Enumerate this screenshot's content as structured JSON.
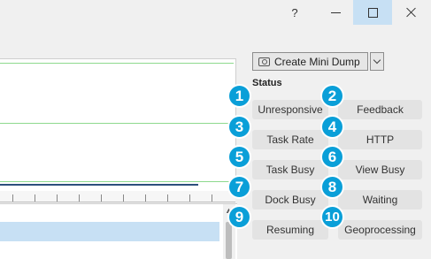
{
  "titlebar": {
    "help_label": "?"
  },
  "toolbar": {
    "mini_dump_label": "Create Mini Dump"
  },
  "status": {
    "label": "Status",
    "buttons": [
      {
        "label": "Unresponsive",
        "badge": "1"
      },
      {
        "label": "Feedback",
        "badge": "2"
      },
      {
        "label": "Task Rate",
        "badge": "3"
      },
      {
        "label": "HTTP",
        "badge": "4"
      },
      {
        "label": "Task Busy",
        "badge": "5"
      },
      {
        "label": "View Busy",
        "badge": "6"
      },
      {
        "label": "Dock Busy",
        "badge": "7"
      },
      {
        "label": "Waiting",
        "badge": "8"
      },
      {
        "label": "Resuming",
        "badge": "9"
      },
      {
        "label": "Geoprocessing",
        "badge": "10"
      }
    ]
  },
  "colors": {
    "accent": "#0a9fd8",
    "selection": "#c7e0f4",
    "grid": "#8ed98e",
    "series": "#2c4f7c"
  }
}
